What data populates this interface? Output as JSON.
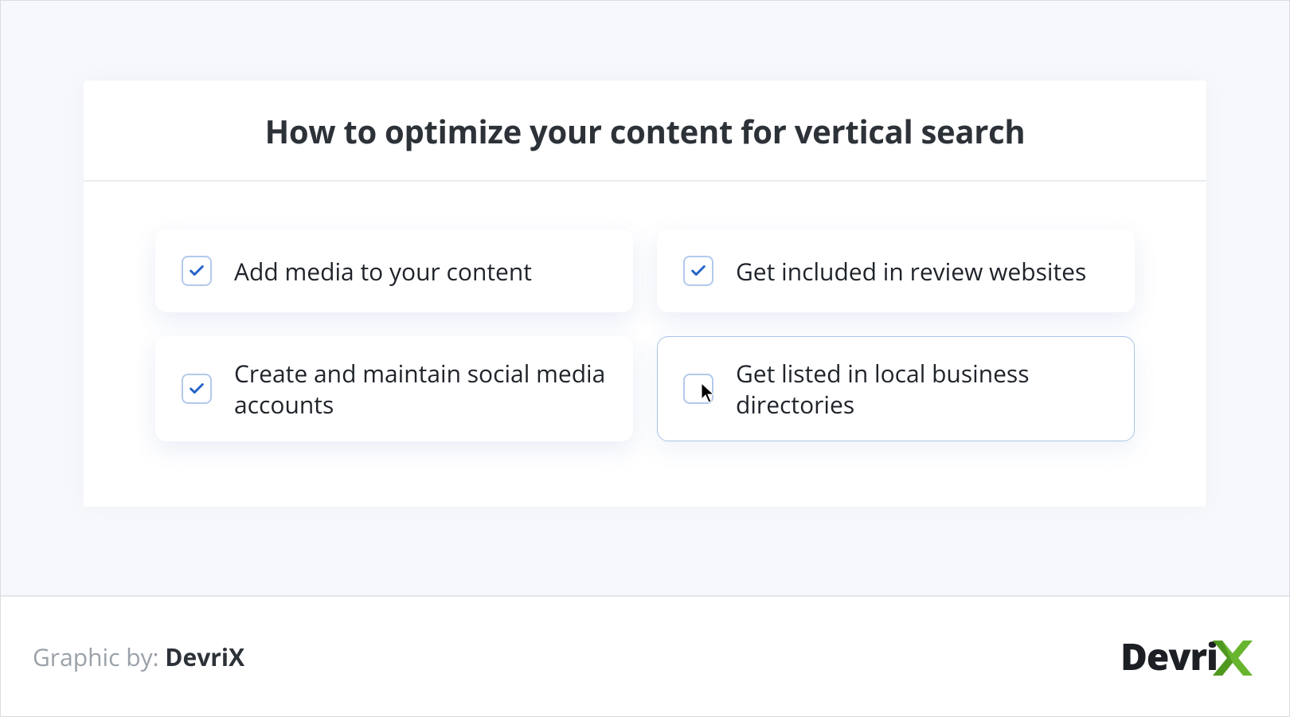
{
  "title": "How to optimize your content for vertical search",
  "items": [
    {
      "label": "Add media to your content",
      "checked": true,
      "selected": false
    },
    {
      "label": "Get included in review websites",
      "checked": true,
      "selected": false
    },
    {
      "label": "Create and maintain social media accounts",
      "checked": true,
      "selected": false
    },
    {
      "label": "Get listed in local business directories",
      "checked": false,
      "selected": true
    }
  ],
  "footer": {
    "attribution_prefix": "Graphic by: ",
    "attribution_brand": "DevriX",
    "logo_text": "Devri"
  }
}
